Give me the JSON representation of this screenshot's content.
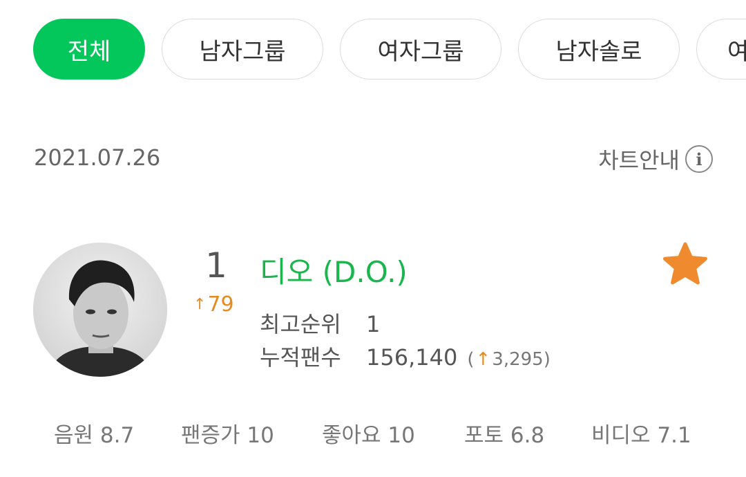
{
  "tabs": [
    {
      "label": "전체",
      "active": true
    },
    {
      "label": "남자그룹",
      "active": false
    },
    {
      "label": "여자그룹",
      "active": false
    },
    {
      "label": "남자솔로",
      "active": false
    },
    {
      "label": "여",
      "active": false
    }
  ],
  "chart": {
    "date": "2021.07.26",
    "guide_label": "차트안내",
    "info_icon": "i"
  },
  "entry": {
    "rank": "1",
    "rank_change_arrow": "↑",
    "rank_change": "79",
    "name": "디오 (D.O.)",
    "best_rank_label": "최고순위",
    "best_rank": "1",
    "fans_label": "누적팬수",
    "fans": "156,140",
    "fans_delta_open": "(",
    "fans_delta_arrow": "↑",
    "fans_delta": "3,295",
    "fans_delta_close": ")",
    "favorite": true
  },
  "scores": [
    {
      "label": "음원",
      "value": "8.7"
    },
    {
      "label": "팬증가",
      "value": "10"
    },
    {
      "label": "좋아요",
      "value": "10"
    },
    {
      "label": "포토",
      "value": "6.8"
    },
    {
      "label": "비디오",
      "value": "7.1"
    }
  ],
  "colors": {
    "accent_green": "#03c75a",
    "name_green": "#1ab54c",
    "rank_up_orange": "#e88a1f",
    "star_orange": "#f08a2e"
  }
}
